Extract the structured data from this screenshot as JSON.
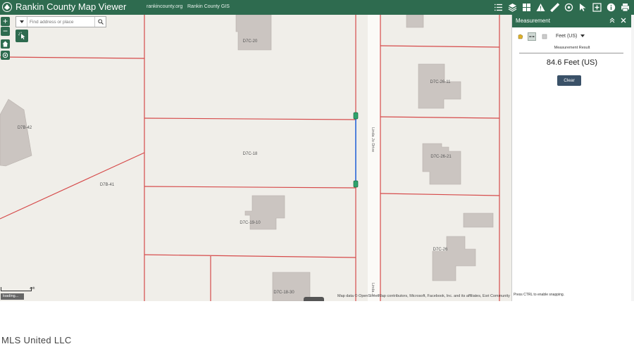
{
  "app": {
    "title": "Rankin County Map Viewer",
    "links": [
      "rankincounty.org",
      "Rankin County GIS"
    ],
    "accent_color": "#2e6b4f",
    "toolbar_icons": [
      "list-icon",
      "layers-icon",
      "basemap-grid-icon",
      "warning-icon",
      "measure-ruler-icon",
      "draw-icon",
      "select-icon",
      "add-data-icon",
      "info-icon",
      "print-icon"
    ]
  },
  "search": {
    "placeholder": "Find address or place"
  },
  "map": {
    "zoom_in": "+",
    "zoom_out": "−",
    "parcel_labels": [
      "D7C-20",
      "D7B-42",
      "D7C-18",
      "D7B-41",
      "D7C-19-10",
      "D7C-18-30",
      "D7C-26-11",
      "D7C-26-21",
      "D7C-26"
    ],
    "street_labels": [
      "Linda Jo Drive",
      "Linda J"
    ],
    "scale_label": "40ft",
    "loading_text": "loading...",
    "attribution": "Map data © OpenStreetMap contributors, Microsoft, Facebook, Inc. and its affiliates, Esri Community Maps contributors"
  },
  "measurement": {
    "title": "Measurement",
    "unit": "Feet (US)",
    "result_label": "Measurement Result",
    "result_value": "84.6 Feet (US)",
    "clear_label": "Clear",
    "tip": "Press CTRL to enable snapping."
  },
  "footer": {
    "brand": "MLS United LLC"
  }
}
